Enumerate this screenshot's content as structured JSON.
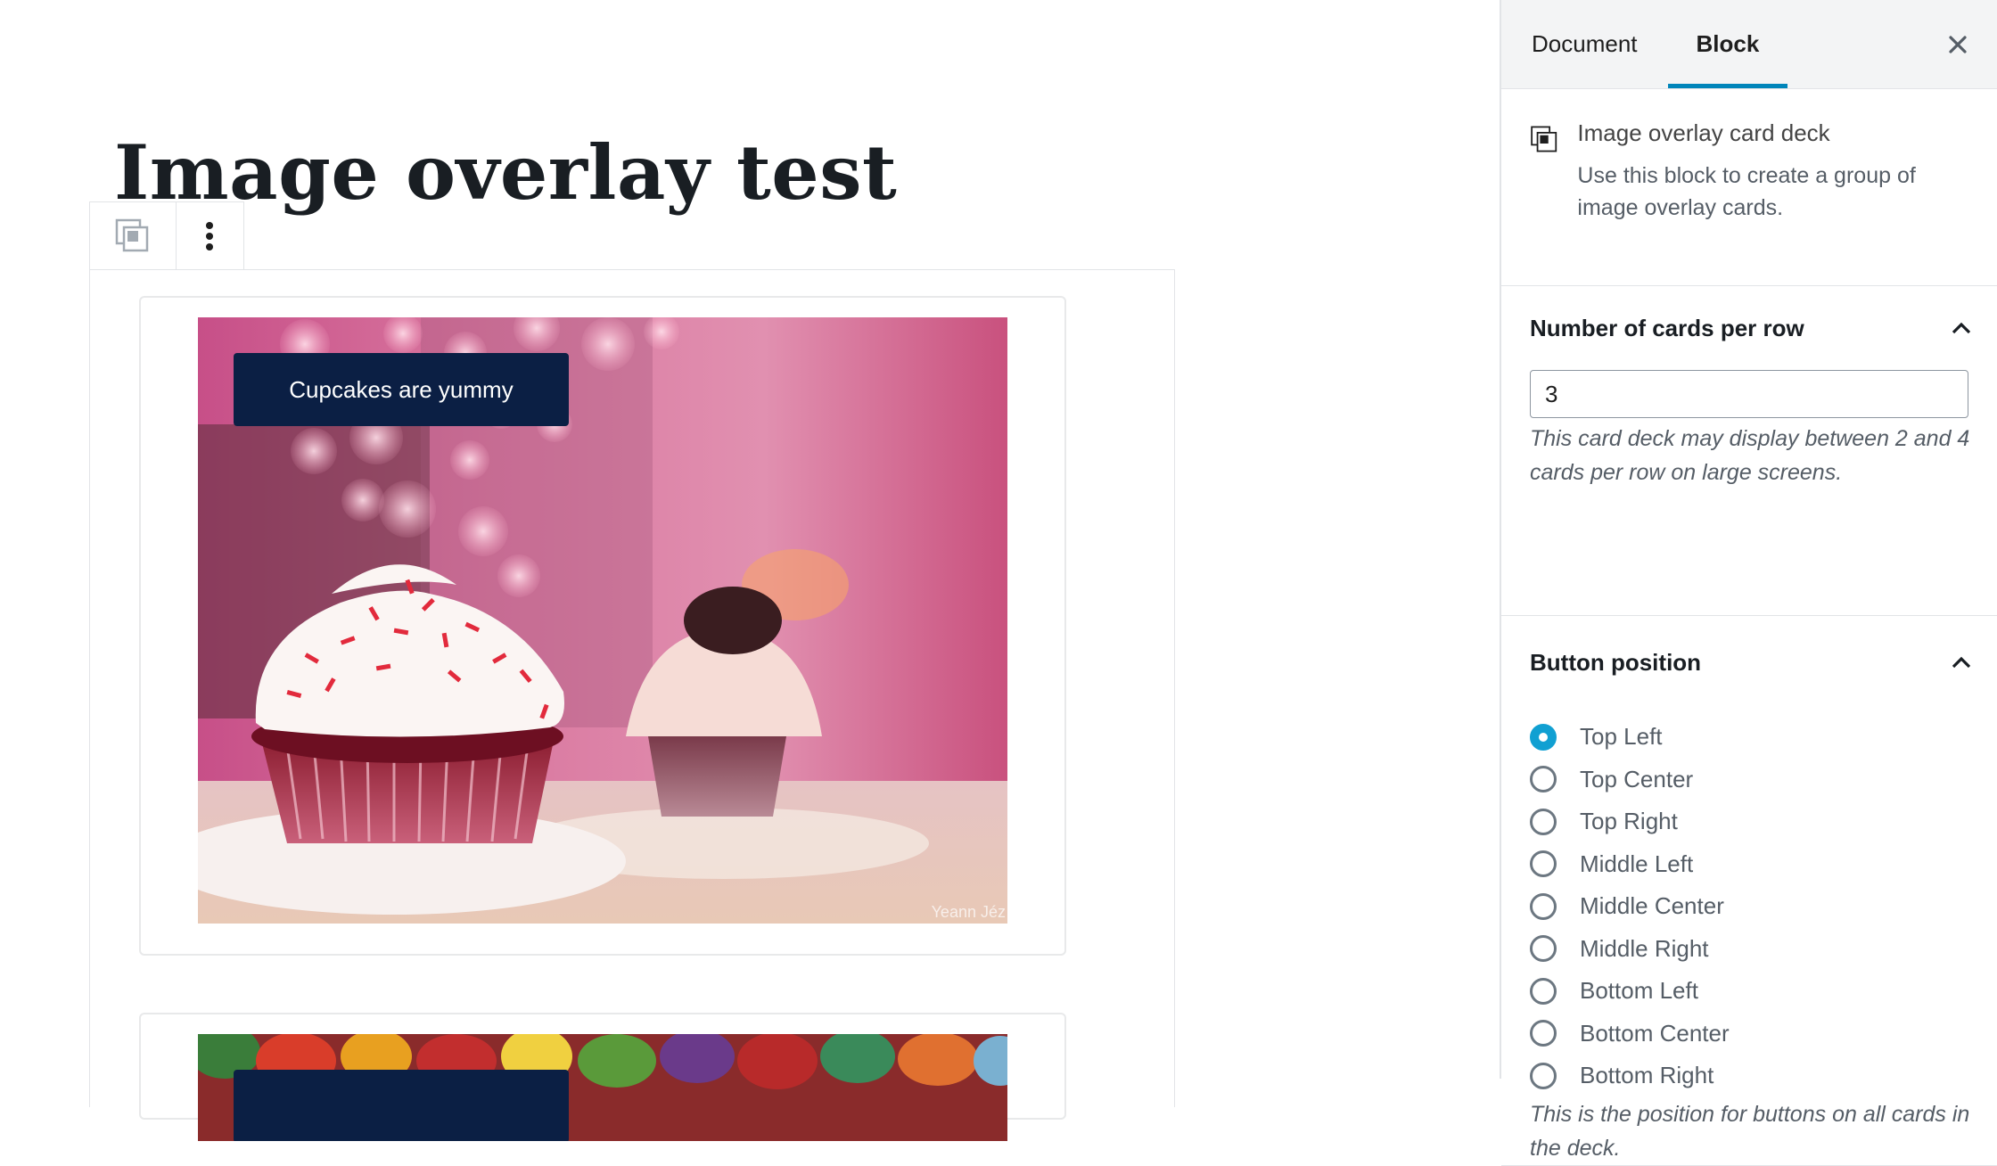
{
  "editor": {
    "post_title": "Image overlay test",
    "cards": [
      {
        "button_label": "Cupcakes are yummy",
        "watermark": "Yeann Jéz"
      },
      {
        "button_label": ""
      }
    ]
  },
  "sidebar": {
    "tabs": [
      {
        "label": "Document",
        "active": false
      },
      {
        "label": "Block",
        "active": true
      }
    ],
    "block_card": {
      "icon": "card-deck-icon",
      "title": "Image overlay card deck",
      "description": "Use this block to create a group of image overlay cards."
    },
    "cards_panel": {
      "title": "Number of cards per row",
      "value": "3",
      "help": "This card deck may display between 2 and 4 cards per row on large screens."
    },
    "button_panel": {
      "title": "Button position",
      "options": [
        {
          "label": "Top Left",
          "checked": true
        },
        {
          "label": "Top Center",
          "checked": false
        },
        {
          "label": "Top Right",
          "checked": false
        },
        {
          "label": "Middle Left",
          "checked": false
        },
        {
          "label": "Middle Center",
          "checked": false
        },
        {
          "label": "Middle Right",
          "checked": false
        },
        {
          "label": "Bottom Left",
          "checked": false
        },
        {
          "label": "Bottom Center",
          "checked": false
        },
        {
          "label": "Bottom Right",
          "checked": false
        }
      ],
      "help": "This is the position for buttons on all cards in the deck."
    }
  },
  "colors": {
    "accent": "#0085ba",
    "radio_checked": "#11a0d2",
    "overlay_button": "#0b1f44"
  }
}
